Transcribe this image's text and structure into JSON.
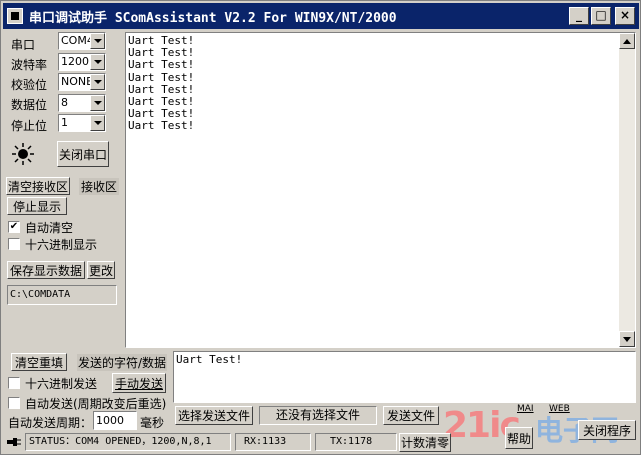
{
  "window": {
    "title": "串口调试助手  SComAssistant V2.2 For WIN9X/NT/2000",
    "minimize": "_",
    "maximize": "□",
    "close": "×"
  },
  "settings": {
    "port_label": "串口",
    "port_value": "COM4",
    "baud_label": "波特率",
    "baud_value": "1200",
    "parity_label": "校验位",
    "parity_value": "NONE",
    "databits_label": "数据位",
    "databits_value": "8",
    "stopbits_label": "停止位",
    "stopbits_value": "1",
    "close_port_button": "关闭串口"
  },
  "receive_panel": {
    "clear_button": "清空接收区",
    "receive_label": "接收区",
    "stop_display_button": "停止显示",
    "auto_clear_label": "自动清空",
    "auto_clear_checked": true,
    "hex_display_label": "十六进制显示",
    "hex_display_checked": false,
    "save_button": "保存显示数据",
    "change_button": "更改",
    "save_path": "C:\\COMDATA"
  },
  "receive_lines": [
    "Uart Test!",
    "Uart Test!",
    "Uart Test!",
    "Uart Test!",
    "Uart Test!",
    "Uart Test!",
    "Uart Test!",
    "Uart Test!"
  ],
  "send_panel": {
    "clear_refill_button": "清空重填",
    "send_chars_label": "发送的字符/数据",
    "hex_send_label": "十六进制发送",
    "hex_send_checked": false,
    "manual_send_button": "手动发送",
    "auto_send_label": "自动发送(周期改变后重选)",
    "auto_send_checked": false,
    "period_label": "自动发送周期：",
    "period_value": "1000",
    "period_unit": "毫秒",
    "send_text": "Uart Test!",
    "select_file_button": "选择发送文件",
    "file_status": "还没有选择文件",
    "send_file_button": "发送文件",
    "help_button": "帮助",
    "close_app_button": "关闭程序",
    "mail_label": "MAI",
    "web_label": "WEB"
  },
  "status_bar": {
    "status_text": "STATUS：COM4 OPENED，1200,N,8,1",
    "rx_text": "RX:1133",
    "tx_text": "TX:1178",
    "count_clear_button": "计数清零"
  },
  "watermark": {
    "site": "21ic",
    "suffix": "电子网"
  }
}
